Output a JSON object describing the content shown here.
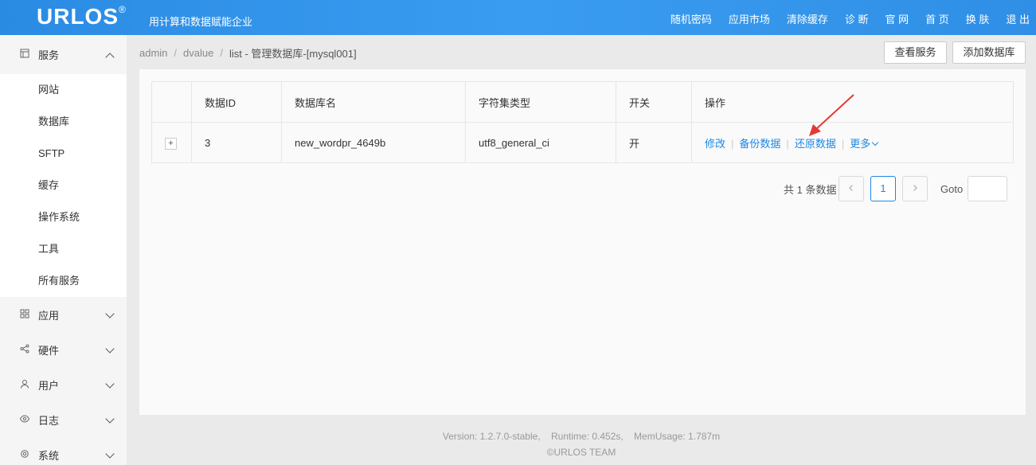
{
  "header": {
    "logo": "URLOS",
    "logo_mark": "®",
    "slogan": "用计算和数据赋能企业",
    "nav": [
      "随机密码",
      "应用市场",
      "清除缓存",
      "诊 断",
      "官 网",
      "首 页",
      "换 肤",
      "退 出"
    ]
  },
  "sidebar": {
    "service_group": {
      "label": "服务",
      "icon": "grid-icon",
      "expanded": true
    },
    "service_items": [
      "网站",
      "数据库",
      "SFTP",
      "缓存",
      "操作系统",
      "工具",
      "所有服务"
    ],
    "groups": [
      {
        "label": "应用",
        "icon": "apps-icon"
      },
      {
        "label": "硬件",
        "icon": "share-icon"
      },
      {
        "label": "用户",
        "icon": "user-icon"
      },
      {
        "label": "日志",
        "icon": "eye-icon"
      },
      {
        "label": "系统",
        "icon": "gear-icon"
      }
    ]
  },
  "breadcrumb": {
    "items": [
      "admin",
      "dvalue"
    ],
    "current": "list  -  管理数据库-[mysql001]"
  },
  "toolbar": {
    "view_services": "查看服务",
    "add_database": "添加数据库"
  },
  "table": {
    "headers": [
      "",
      "数据ID",
      "数据库名",
      "字符集类型",
      "开关",
      "操作"
    ],
    "rows": [
      {
        "expand": "+",
        "id": "3",
        "name": "new_wordpr_4649b",
        "charset": "utf8_general_ci",
        "switch": "开",
        "actions": {
          "edit": "修改",
          "backup": "备份数据",
          "restore": "还原数据",
          "more": "更多"
        }
      }
    ]
  },
  "pagination": {
    "total": "共 1 条数据",
    "current_page": "1",
    "goto_label": "Goto"
  },
  "footer": {
    "version_line": "Version: 1.2.7.0-stable,    Runtime: 0.452s,    MemUsage: 1.787m",
    "copyright": "©URLOS TEAM"
  },
  "colors": {
    "header": "#2f8fe6",
    "link": "#1e88e5",
    "arrow": "#e53935"
  }
}
